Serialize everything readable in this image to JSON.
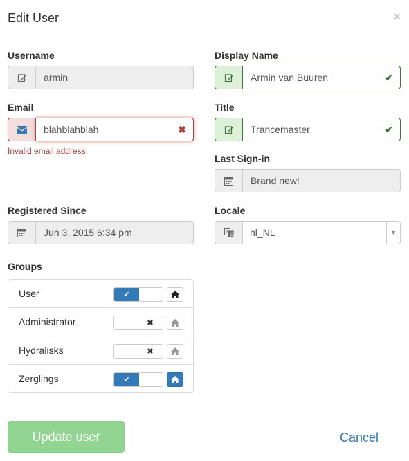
{
  "header": {
    "title": "Edit User",
    "close_label": "×"
  },
  "username": {
    "label": "Username",
    "value": "armin"
  },
  "display_name": {
    "label": "Display Name",
    "value": "Armin van Buuren"
  },
  "email": {
    "label": "Email",
    "value": "blahblahblah",
    "error": "Invalid email address"
  },
  "title": {
    "label": "Title",
    "value": "Trancemaster"
  },
  "last_signin": {
    "label": "Last Sign-in",
    "value": "Brand new!"
  },
  "registered": {
    "label": "Registered Since",
    "value": "Jun 3, 2015 6:34 pm"
  },
  "locale": {
    "label": "Locale",
    "value": "nl_NL"
  },
  "groups": {
    "label": "Groups",
    "items": [
      {
        "name": "User",
        "enabled": true,
        "home": "outline"
      },
      {
        "name": "Administrator",
        "enabled": false,
        "home": "dim"
      },
      {
        "name": "Hydralisks",
        "enabled": false,
        "home": "dim"
      },
      {
        "name": "Zerglings",
        "enabled": true,
        "home": "active"
      }
    ]
  },
  "footer": {
    "update_label": "Update user",
    "cancel_label": "Cancel"
  },
  "colors": {
    "success": "#3c763d",
    "error": "#a94442",
    "primary": "#337ab7",
    "update_button": "#92d492"
  }
}
